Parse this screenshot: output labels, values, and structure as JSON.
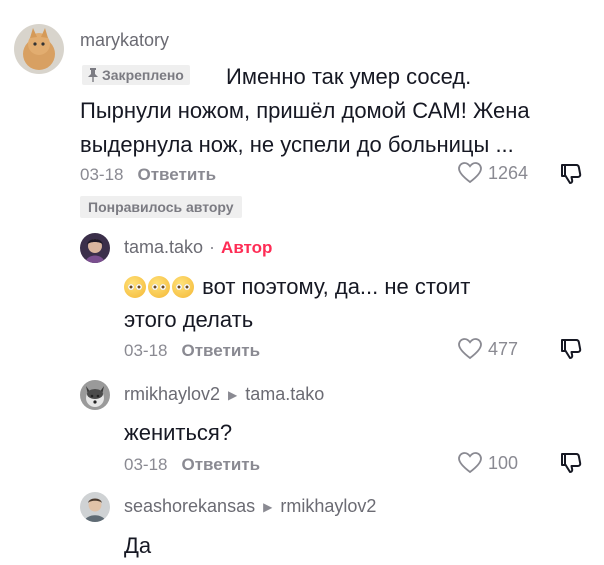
{
  "comments": [
    {
      "username": "marykatory",
      "pinned_label": "Закреплено",
      "text_line1": "Именно так умер сосед.",
      "text_line2": "Пырнули ножом, пришёл домой САМ! Жена",
      "text_line3": "выдернула нож, не успели до больницы ...",
      "date": "03-18",
      "reply_label": "Ответить",
      "likes": "1264",
      "liked_by_author_label": "Понравилось автору"
    },
    {
      "username": "tama.tako",
      "separator": "·",
      "author_label": "Автор",
      "text_line1": "вот поэтому, да... не стоит",
      "text_line2": "этого делать",
      "date": "03-18",
      "reply_label": "Ответить",
      "likes": "477"
    },
    {
      "username": "rmikhaylov2",
      "reply_to": "tama.tako",
      "text_line1": "жениться?",
      "date": "03-18",
      "reply_label": "Ответить",
      "likes": "100"
    },
    {
      "username": "seashorekansas",
      "reply_to": "rmikhaylov2",
      "text_line1": "Да"
    }
  ],
  "icons": {
    "pin": "pin-icon",
    "heart": "heart-icon",
    "dislike": "dislike-icon",
    "reply_arrow": "reply-arrow-icon"
  },
  "colors": {
    "author_badge": "#fe2c55",
    "secondary_text": "#8a8a92"
  }
}
